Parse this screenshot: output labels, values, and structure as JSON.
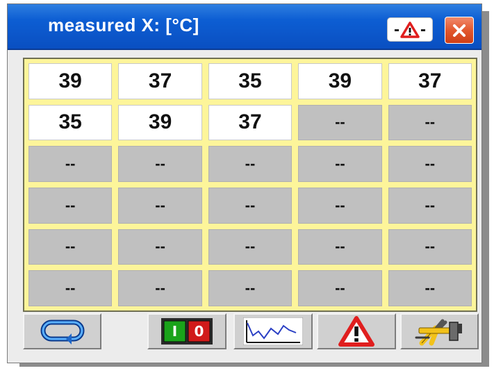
{
  "window": {
    "title": "measured X: [°C]",
    "warning_button": {
      "left": "-",
      "right": "-",
      "icon": "warning-triangle-icon"
    },
    "close_button": {
      "icon": "close-icon"
    }
  },
  "grid": {
    "rows": [
      [
        "39",
        "37",
        "35",
        "39",
        "37"
      ],
      [
        "35",
        "39",
        "37",
        "--",
        "--"
      ],
      [
        "--",
        "--",
        "--",
        "--",
        "--"
      ],
      [
        "--",
        "--",
        "--",
        "--",
        "--"
      ],
      [
        "--",
        "--",
        "--",
        "--",
        "--"
      ],
      [
        "--",
        "--",
        "--",
        "--",
        "--"
      ]
    ],
    "colors": {
      "frame": "#fdf59a",
      "value_cell": "#ffffff",
      "empty_cell": "#c0c0c0"
    }
  },
  "toolbar": {
    "buttons": [
      {
        "name": "loop-button",
        "icon": "loop-arrow-icon"
      },
      {
        "name": "on-off-button",
        "icon": "on-off-switch-icon",
        "on_label": "I",
        "off_label": "0"
      },
      {
        "name": "trend-chart-button",
        "icon": "line-chart-icon"
      },
      {
        "name": "alarm-button",
        "icon": "warning-triangle-icon"
      },
      {
        "name": "tools-button",
        "icon": "tools-icon"
      }
    ]
  },
  "colors": {
    "titlebar": "#0d5ed3",
    "close": "#e2582e",
    "warning_red": "#e01e1e",
    "switch_green": "#1aa31a",
    "switch_red": "#d11a1a"
  }
}
